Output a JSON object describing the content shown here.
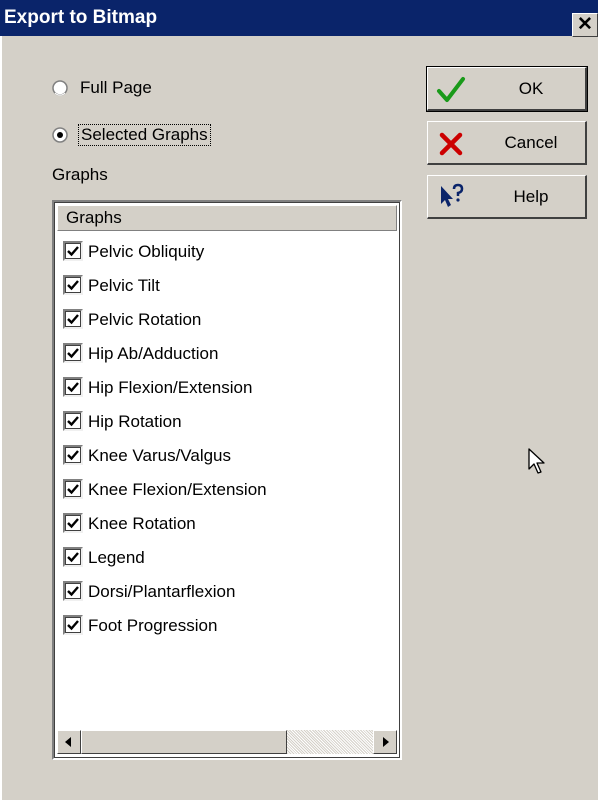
{
  "window": {
    "title": "Export to Bitmap",
    "close_glyph": "✕"
  },
  "options": {
    "full_page": {
      "label": "Full Page",
      "selected": false
    },
    "selected_graphs": {
      "label": "Selected Graphs",
      "selected": true
    }
  },
  "graphs_label": "Graphs",
  "list": {
    "header": "Graphs",
    "items": [
      {
        "label": "Pelvic Obliquity",
        "checked": true
      },
      {
        "label": "Pelvic Tilt",
        "checked": true
      },
      {
        "label": "Pelvic Rotation",
        "checked": true
      },
      {
        "label": "Hip Ab/Adduction",
        "checked": true
      },
      {
        "label": "Hip Flexion/Extension",
        "checked": true
      },
      {
        "label": "Hip Rotation",
        "checked": true
      },
      {
        "label": "Knee Varus/Valgus",
        "checked": true
      },
      {
        "label": "Knee Flexion/Extension",
        "checked": true
      },
      {
        "label": "Knee Rotation",
        "checked": true
      },
      {
        "label": "Legend",
        "checked": true
      },
      {
        "label": "Dorsi/Plantarflexion",
        "checked": true
      },
      {
        "label": "Foot Progression",
        "checked": true
      }
    ]
  },
  "buttons": {
    "ok": {
      "label": "OK",
      "icon": "check-icon"
    },
    "cancel": {
      "label": "Cancel",
      "icon": "x-icon"
    },
    "help": {
      "label": "Help",
      "icon": "help-arrow-icon"
    }
  },
  "colors": {
    "titlebar": "#0a246a",
    "dialog_bg": "#d4d0c8",
    "ok_check": "#1a9a1a",
    "cancel_x": "#cc0000",
    "help_icon": "#0a246a"
  }
}
